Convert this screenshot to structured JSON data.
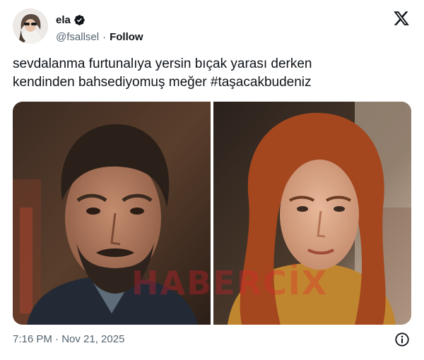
{
  "author": {
    "display_name": "ela",
    "handle": "@fsallsel",
    "follow_label": "Follow",
    "separator": "·",
    "verified": true,
    "avatar": "avatar-photo"
  },
  "tweet": {
    "text": "sevdalanma furtunalıya yersin bıçak yarası derken\nkendinden bahsediyomuş meğer #taşacakbudeniz"
  },
  "media": {
    "watermark": "HABERCİX",
    "photos": [
      "man-portrait",
      "woman-portrait"
    ]
  },
  "footer": {
    "timestamp": "7:16 PM · Nov 21, 2025",
    "info_icon": "info-icon"
  },
  "colors": {
    "text": "#0f1419",
    "secondary": "#536471",
    "verified": "#1d9bf0",
    "watermark": "#e11e2d"
  },
  "icons": {
    "brand": "x-logo-icon",
    "verified": "verified-badge-icon"
  }
}
